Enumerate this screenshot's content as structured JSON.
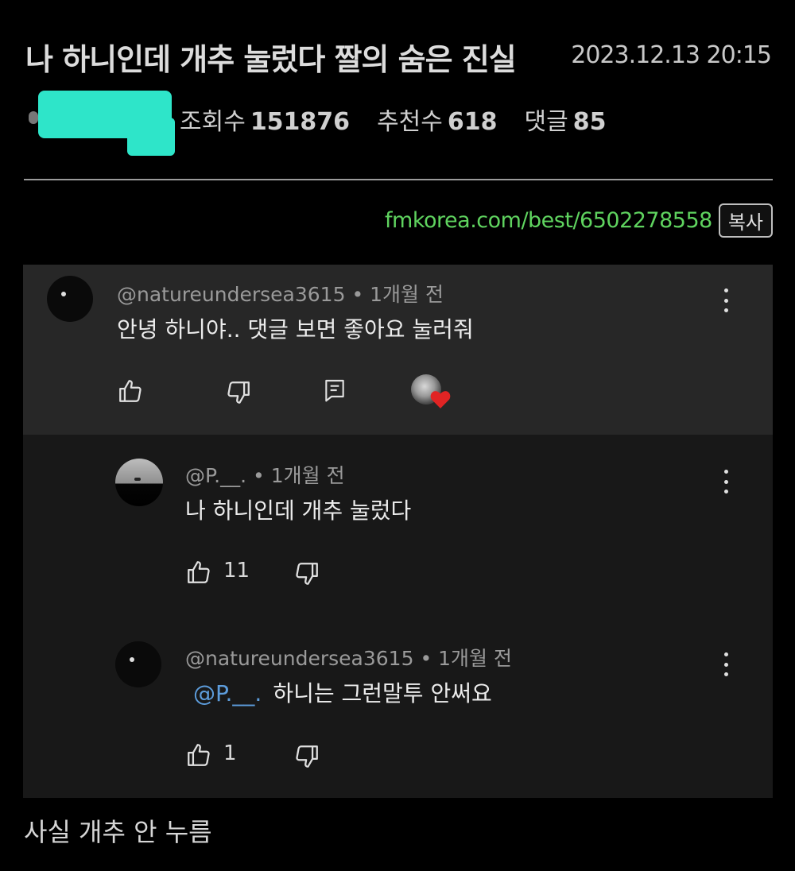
{
  "post": {
    "title": "나 하니인데 개추 눌렀다 짤의 숨은 진실",
    "date": "2023.12.13 20:15",
    "views_label": "조회수",
    "views": "151876",
    "recommend_label": "추천수",
    "recommend": "618",
    "comments_label": "댓글",
    "comments": "85",
    "link": "fmkorea.com/best/6502278558",
    "copy_label": "복사",
    "body_text": "사실 개추 안 누름"
  },
  "colors": {
    "background": "#000000",
    "panel_main": "#272727",
    "panel_reply": "#181818",
    "link_green": "#5fd35f",
    "mention_blue": "#5d9ddc",
    "censor_teal": "#2ee5c9",
    "heart_red": "#e02424"
  },
  "comment_screenshot": {
    "main_comment": {
      "author": "@natureundersea3615",
      "time": "• 1개월 전",
      "text": "안녕 하니야.. 댓글 보면 좋아요 눌러줘",
      "icons": [
        "like-icon",
        "dislike-icon",
        "reply-icon",
        "creator-heart-icon",
        "more-icon"
      ]
    },
    "replies": [
      {
        "author": "@P.__.",
        "time": "• 1개월 전",
        "text": "나 하니인데 개추 눌렀다",
        "likes": "11"
      },
      {
        "author": "@natureundersea3615",
        "time": "• 1개월 전",
        "mention": "@P.__.",
        "text": "하니는 그런말투 안써요",
        "likes": "1"
      }
    ]
  }
}
